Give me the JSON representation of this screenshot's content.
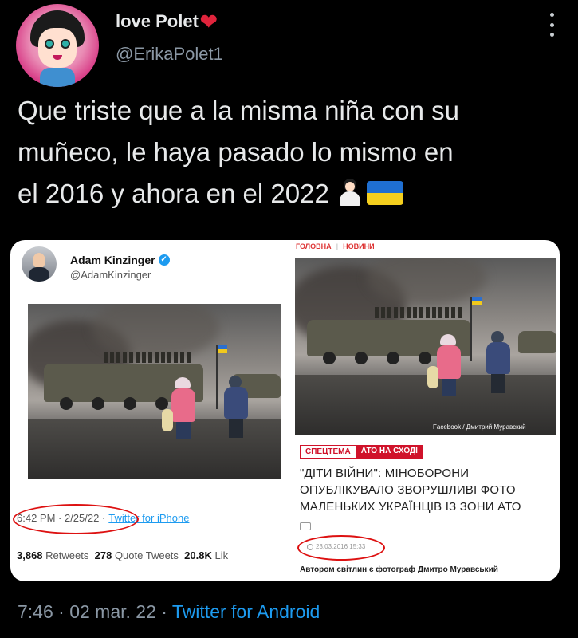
{
  "user": {
    "display_name": "love Polet",
    "name_emoji": "heart",
    "handle": "@ErikaPolet1"
  },
  "tweet": {
    "text_line1": "Que triste que a la misma niña con su",
    "text_line2": "muñeco, le haya pasado lo mismo en",
    "text_line3": "el 2016 y ahora en el 2022",
    "emojis": [
      "person-shrugging-emoji",
      "ukraine-flag-emoji"
    ]
  },
  "embedded_left": {
    "name": "Adam Kinzinger",
    "handle": "@AdamKinzinger",
    "time": "6:42 PM · 2/25/22 ·",
    "client": "Twitter for iPhone",
    "retweets_count": "3,868",
    "retweets_label": "Retweets",
    "quotes_count": "278",
    "quotes_label": "Quote Tweets",
    "likes_count": "20.8K",
    "likes_label": "Lik"
  },
  "embedded_right": {
    "nav_home": "ГОЛОВНА",
    "nav_news": "НОВИНИ",
    "photo_credit": "Facebook / Дмитрий Муравский",
    "tag_special": "СПЕЦТЕМА",
    "tag_ato": "АТО НА СХОДІ",
    "headline": "\"ДІТИ ВІЙНИ\": МІНОБОРОНИ ОПУБЛІКУВАЛО ЗВОРУШЛИВІ ФОТО МАЛЕНЬКИХ УКРАЇНЦІВ ІЗ ЗОНИ АТО",
    "date": "23.03.2016 15:33",
    "caption": "Автором світлин є фотограф Дмитро Муравський"
  },
  "footer": {
    "time": "7:46 · 02 mar. 22 ·",
    "client": "Twitter for Android"
  },
  "colors": {
    "background": "#000000",
    "text": "#e7e9ea",
    "muted": "#8b98a5",
    "link": "#1d9bf0",
    "annotation_red": "#dd1111"
  }
}
